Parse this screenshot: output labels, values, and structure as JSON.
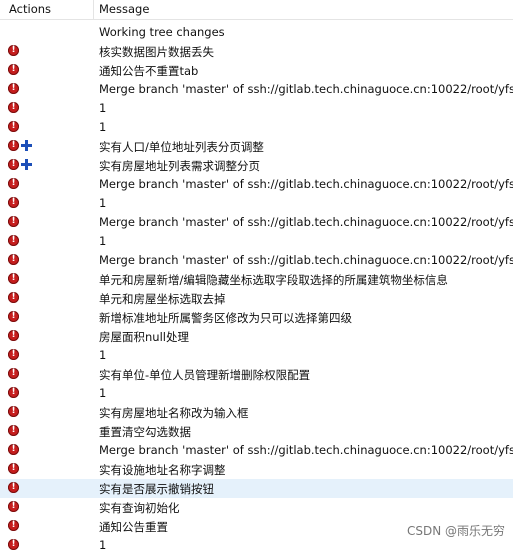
{
  "header": {
    "actions": "Actions",
    "message": "Message"
  },
  "rows": [
    {
      "message": "Working tree changes",
      "icons": []
    },
    {
      "message": "核实数据图片数据丢失",
      "icons": [
        "error"
      ]
    },
    {
      "message": "通知公告不重置tab",
      "icons": [
        "error"
      ]
    },
    {
      "message": "Merge branch 'master' of ssh://gitlab.tech.chinaguoce.cn:10022/root/yfs-polic",
      "icons": [
        "error"
      ]
    },
    {
      "message": "1",
      "icons": [
        "error"
      ]
    },
    {
      "message": "1",
      "icons": [
        "error"
      ]
    },
    {
      "message": "实有人口/单位地址列表分页调整",
      "icons": [
        "error",
        "added"
      ]
    },
    {
      "message": "实有房屋地址列表需求调整分页",
      "icons": [
        "error",
        "added"
      ]
    },
    {
      "message": "Merge branch 'master' of ssh://gitlab.tech.chinaguoce.cn:10022/root/yfs-polic",
      "icons": [
        "error"
      ]
    },
    {
      "message": "1",
      "icons": [
        "error"
      ]
    },
    {
      "message": "Merge branch 'master' of ssh://gitlab.tech.chinaguoce.cn:10022/root/yfs-polic",
      "icons": [
        "error"
      ]
    },
    {
      "message": "1",
      "icons": [
        "error"
      ]
    },
    {
      "message": "Merge branch 'master' of ssh://gitlab.tech.chinaguoce.cn:10022/root/yfs-polic",
      "icons": [
        "error"
      ]
    },
    {
      "message": "单元和房屋新增/编辑隐藏坐标选取字段取选择的所属建筑物坐标信息",
      "icons": [
        "error"
      ]
    },
    {
      "message": "单元和房屋坐标选取去掉",
      "icons": [
        "error"
      ]
    },
    {
      "message": "新增标准地址所属警务区修改为只可以选择第四级",
      "icons": [
        "error"
      ]
    },
    {
      "message": "房屋面积null处理",
      "icons": [
        "error"
      ]
    },
    {
      "message": "1",
      "icons": [
        "error"
      ]
    },
    {
      "message": "实有单位-单位人员管理新增删除权限配置",
      "icons": [
        "error"
      ]
    },
    {
      "message": "1",
      "icons": [
        "error"
      ]
    },
    {
      "message": "实有房屋地址名称改为输入框",
      "icons": [
        "error"
      ]
    },
    {
      "message": "重置清空勾选数据",
      "icons": [
        "error"
      ]
    },
    {
      "message": "Merge branch 'master' of ssh://gitlab.tech.chinaguoce.cn:10022/root/yfs-polic",
      "icons": [
        "error"
      ]
    },
    {
      "message": "实有设施地址名称字调整",
      "icons": [
        "error"
      ]
    },
    {
      "message": "实有是否展示撤销按钮",
      "icons": [
        "error"
      ],
      "selected": true
    },
    {
      "message": "实有查询初始化",
      "icons": [
        "error"
      ]
    },
    {
      "message": "通知公告重置",
      "icons": [
        "error"
      ]
    },
    {
      "message": "1",
      "icons": [
        "error"
      ]
    }
  ],
  "watermark": "CSDN @雨乐无穷",
  "colors": {
    "selected_row": "#e5f1fb",
    "error_icon": "#c61d1d",
    "added_icon": "#1c4fb8"
  }
}
